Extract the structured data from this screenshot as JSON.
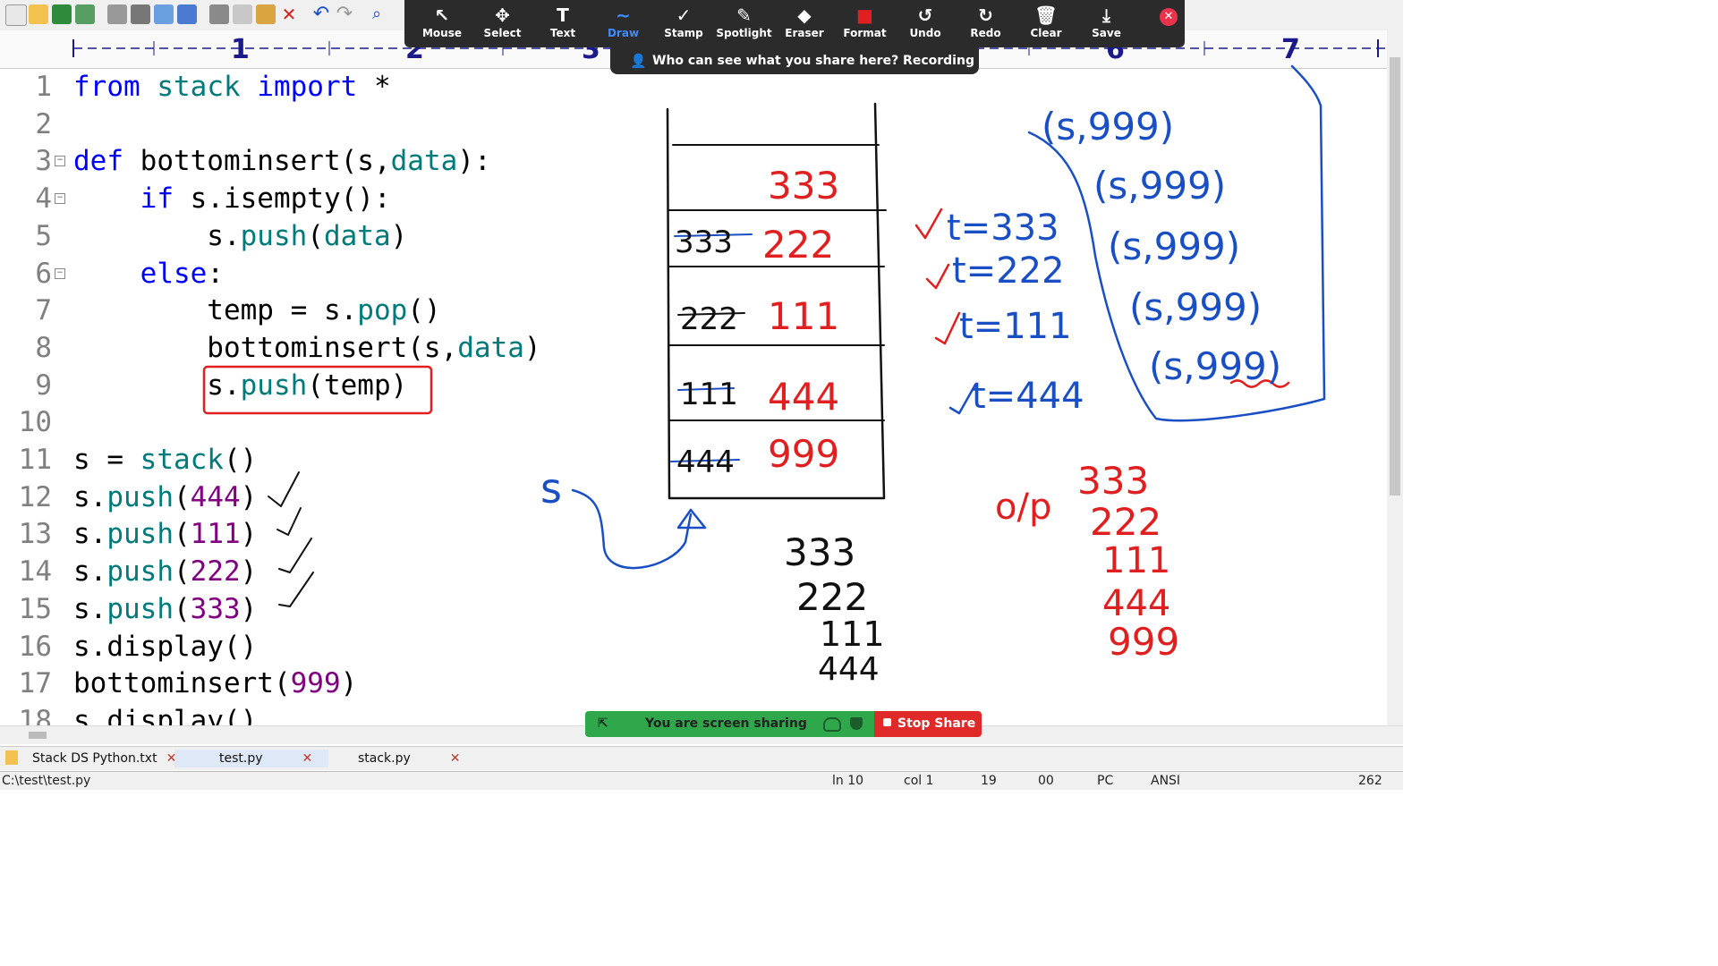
{
  "ruler": {
    "marks": [
      "1",
      "2",
      "3",
      "6",
      "7"
    ]
  },
  "code": [
    {
      "n": "1",
      "tokens": [
        {
          "t": "from ",
          "c": "kw"
        },
        {
          "t": "stack ",
          "c": "tl"
        },
        {
          "t": "import ",
          "c": "kw"
        },
        {
          "t": "*",
          "c": ""
        }
      ]
    },
    {
      "n": "2",
      "tokens": []
    },
    {
      "n": "3",
      "fold": true,
      "tokens": [
        {
          "t": "def ",
          "c": "kw"
        },
        {
          "t": "bottominsert(s,",
          "c": ""
        },
        {
          "t": "data",
          "c": "tl"
        },
        {
          "t": "):",
          "c": ""
        }
      ]
    },
    {
      "n": "4",
      "fold": true,
      "tokens": [
        {
          "t": "    if ",
          "c": "kw"
        },
        {
          "t": "s.isempty():",
          "c": ""
        }
      ]
    },
    {
      "n": "5",
      "tokens": [
        {
          "t": "        s.",
          "c": ""
        },
        {
          "t": "push",
          "c": "tl"
        },
        {
          "t": "(",
          "c": ""
        },
        {
          "t": "data",
          "c": "tl"
        },
        {
          "t": ")",
          "c": ""
        }
      ]
    },
    {
      "n": "6",
      "fold": true,
      "tokens": [
        {
          "t": "    else",
          "c": "kw"
        },
        {
          "t": ":",
          "c": ""
        }
      ]
    },
    {
      "n": "7",
      "tokens": [
        {
          "t": "        temp = s.",
          "c": ""
        },
        {
          "t": "pop",
          "c": "tl"
        },
        {
          "t": "()",
          "c": ""
        }
      ]
    },
    {
      "n": "8",
      "tokens": [
        {
          "t": "        bottominsert(s,",
          "c": ""
        },
        {
          "t": "data",
          "c": "tl"
        },
        {
          "t": ")",
          "c": ""
        }
      ]
    },
    {
      "n": "9",
      "tokens": [
        {
          "t": "        s.",
          "c": ""
        },
        {
          "t": "push",
          "c": "tl"
        },
        {
          "t": "(temp)",
          "c": ""
        }
      ]
    },
    {
      "n": "10",
      "tokens": []
    },
    {
      "n": "11",
      "tokens": [
        {
          "t": "s = ",
          "c": ""
        },
        {
          "t": "stack",
          "c": "tl"
        },
        {
          "t": "()",
          "c": ""
        }
      ]
    },
    {
      "n": "12",
      "tokens": [
        {
          "t": "s.",
          "c": ""
        },
        {
          "t": "push",
          "c": "tl"
        },
        {
          "t": "(",
          "c": ""
        },
        {
          "t": "444",
          "c": "num"
        },
        {
          "t": ")",
          "c": ""
        }
      ]
    },
    {
      "n": "13",
      "tokens": [
        {
          "t": "s.",
          "c": ""
        },
        {
          "t": "push",
          "c": "tl"
        },
        {
          "t": "(",
          "c": ""
        },
        {
          "t": "111",
          "c": "num"
        },
        {
          "t": ")",
          "c": ""
        }
      ]
    },
    {
      "n": "14",
      "tokens": [
        {
          "t": "s.",
          "c": ""
        },
        {
          "t": "push",
          "c": "tl"
        },
        {
          "t": "(",
          "c": ""
        },
        {
          "t": "222",
          "c": "num"
        },
        {
          "t": ")",
          "c": ""
        }
      ]
    },
    {
      "n": "15",
      "tokens": [
        {
          "t": "s.",
          "c": ""
        },
        {
          "t": "push",
          "c": "tl"
        },
        {
          "t": "(",
          "c": ""
        },
        {
          "t": "333",
          "c": "num"
        },
        {
          "t": ")",
          "c": ""
        }
      ]
    },
    {
      "n": "16",
      "tokens": [
        {
          "t": "s.display()",
          "c": ""
        }
      ]
    },
    {
      "n": "17",
      "tokens": [
        {
          "t": "bottominsert(",
          "c": ""
        },
        {
          "t": "999",
          "c": "num"
        },
        {
          "t": ")",
          "c": ""
        }
      ]
    },
    {
      "n": "18",
      "tokens": [
        {
          "t": "s.display()",
          "c": ""
        }
      ]
    }
  ],
  "zoom_toolbar": {
    "items": [
      {
        "name": "mouse",
        "label": "Mouse",
        "icon": "↖"
      },
      {
        "name": "select",
        "label": "Select",
        "icon": "✥"
      },
      {
        "name": "text",
        "label": "Text",
        "icon": "T"
      },
      {
        "name": "draw",
        "label": "Draw",
        "icon": "∼",
        "active": true
      },
      {
        "name": "stamp",
        "label": "Stamp",
        "icon": "✓"
      },
      {
        "name": "spotlight",
        "label": "Spotlight",
        "icon": "✎"
      },
      {
        "name": "eraser",
        "label": "Eraser",
        "icon": "◆"
      },
      {
        "name": "format",
        "label": "Format",
        "icon": "■"
      },
      {
        "name": "undo",
        "label": "Undo",
        "icon": "↺"
      },
      {
        "name": "redo",
        "label": "Redo",
        "icon": "↻"
      },
      {
        "name": "clear",
        "label": "Clear",
        "icon": "🗑"
      },
      {
        "name": "save",
        "label": "Save",
        "icon": "⤓"
      }
    ],
    "format_color": "#e02020"
  },
  "recording_bar": {
    "text": "Who can see what you share here? Recording On"
  },
  "sharing_bar": {
    "status": "You are screen sharing",
    "stop": "Stop Share"
  },
  "tabs": [
    {
      "label": "Stack DS Python.txt"
    },
    {
      "label": "test.py",
      "active": true
    },
    {
      "label": "stack.py"
    }
  ],
  "statusbar": {
    "path": "C:\\test\\test.py",
    "ln": "ln 10",
    "col": "col 1",
    "sel": "19",
    "c00": "00",
    "eol": "PC",
    "enc": "ANSI",
    "num": "262"
  },
  "annotations": {
    "stack_cells": [
      {
        "old": "",
        "new": "333"
      },
      {
        "old": "333",
        "new": "222"
      },
      {
        "old": "222",
        "new": "111"
      },
      {
        "old": "111",
        "new": "444"
      },
      {
        "old": "444",
        "new": "999"
      }
    ],
    "stack_label": "s",
    "printed_column": [
      "333",
      "222",
      "111",
      "444"
    ],
    "temp_values": [
      "t=333",
      "t=222",
      "t=111",
      "t=444"
    ],
    "calls": [
      "(s,999)",
      "(s,999)",
      "(s,999)",
      "(s,999)",
      "(s,999)"
    ],
    "output_label": "o/p",
    "output_values": [
      "333",
      "222",
      "111",
      "444",
      "999"
    ],
    "colors": {
      "blue": "#1a4fc4",
      "red": "#e02020",
      "black": "#111111"
    }
  }
}
